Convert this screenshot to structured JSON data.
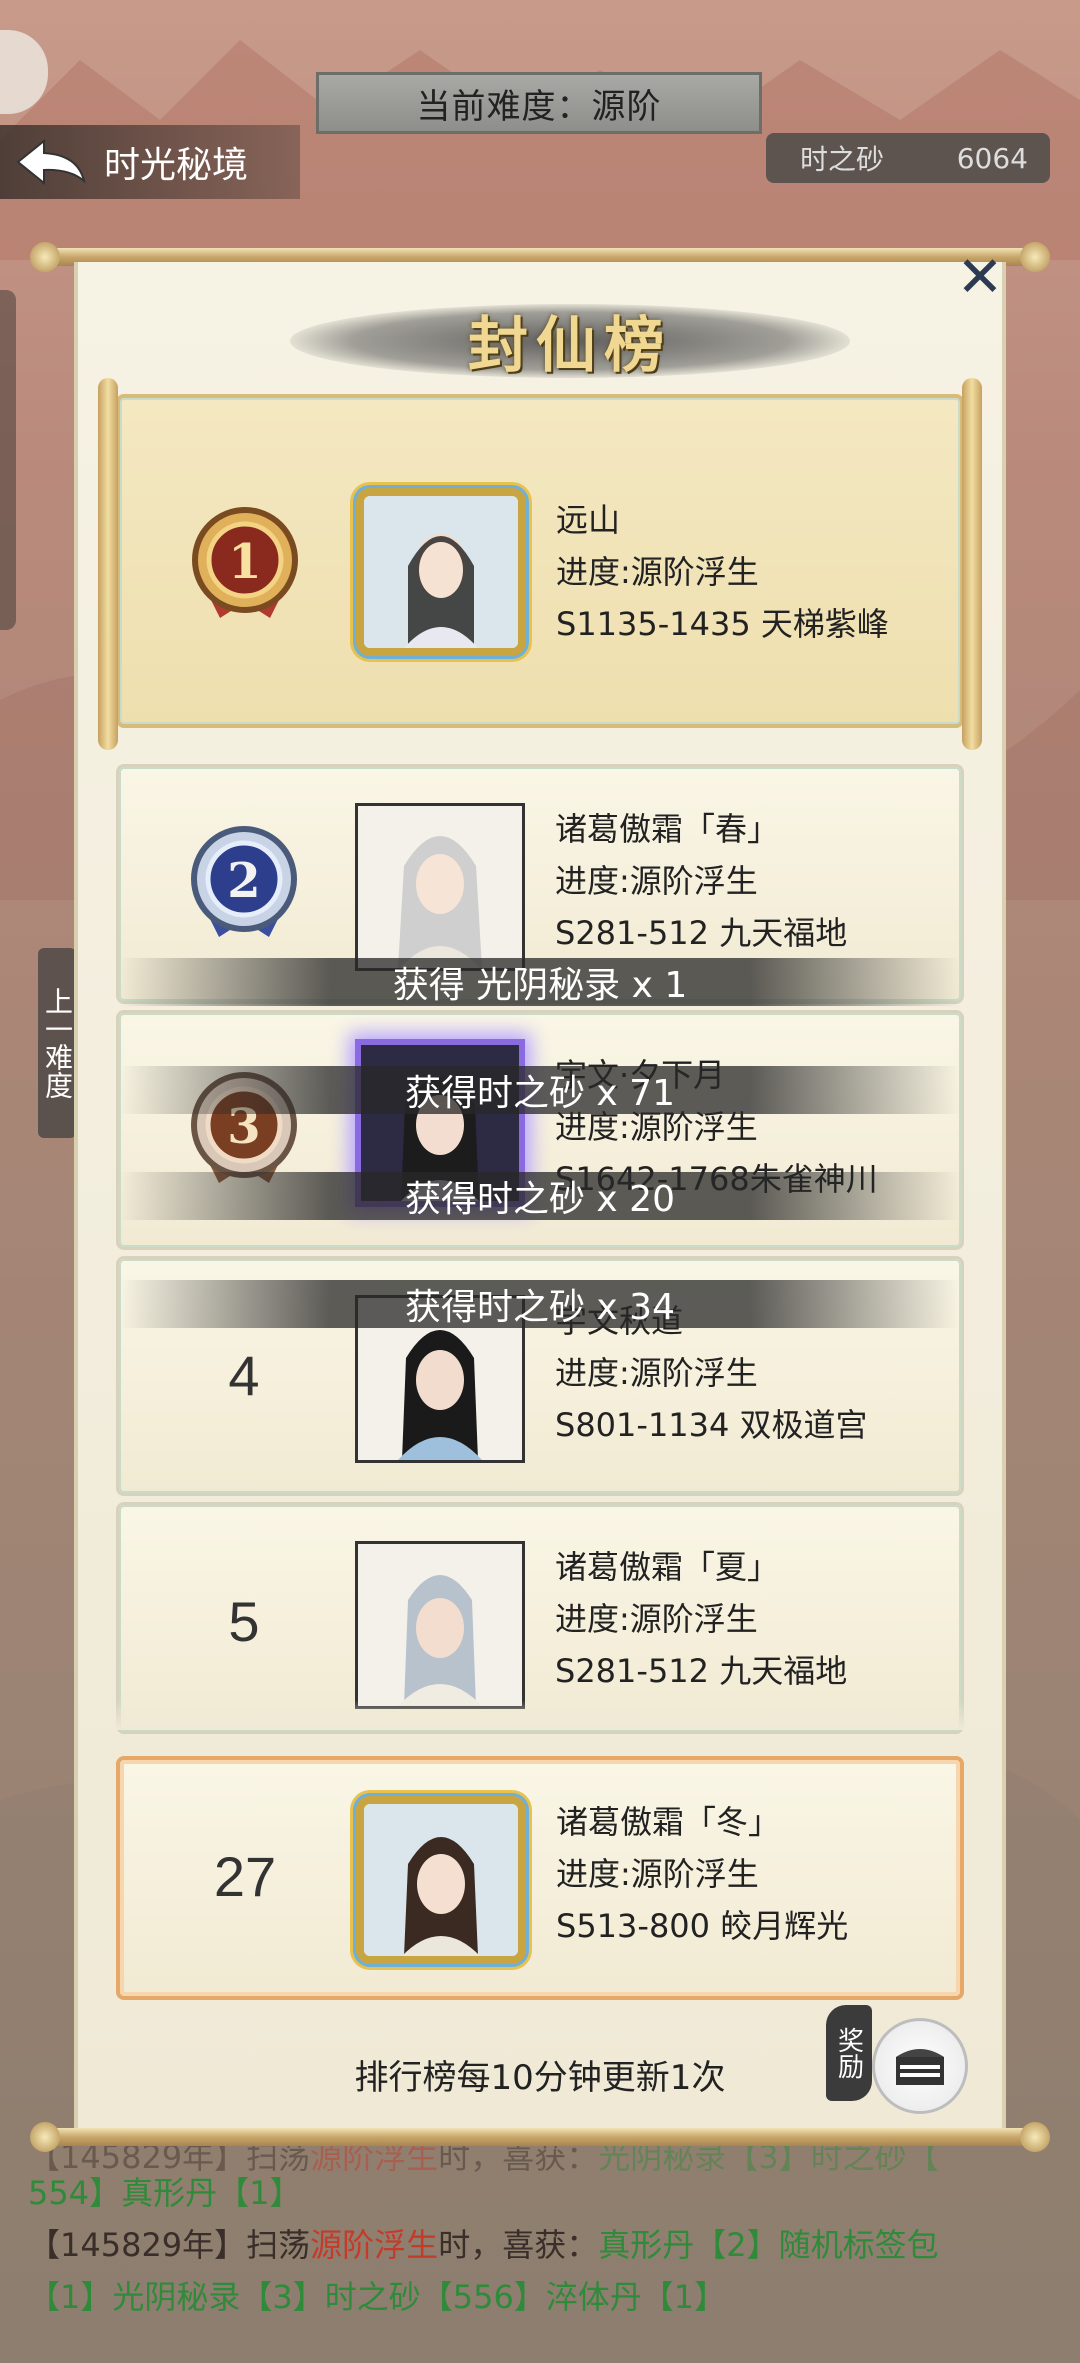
{
  "header": {
    "back_label": "时光秘境",
    "difficulty_label": "当前难度：源阶",
    "currency_label": "时之砂",
    "currency_value": "6064",
    "prev_difficulty_label": "上一难度"
  },
  "panel": {
    "title": "封仙榜",
    "close_label": "✕",
    "footer_note": "排行榜每10分钟更新1次",
    "reward_label": "奖励"
  },
  "ranks": [
    {
      "rank": "1",
      "name": "远山",
      "progress": "进度:源阶浮生",
      "server": "S1135-1435 天梯紫峰"
    },
    {
      "rank": "2",
      "name": "诸葛傲霜「春」",
      "progress": "进度:源阶浮生",
      "server": "S281-512 九天福地"
    },
    {
      "rank": "3",
      "name": "宇文·夕下月",
      "progress": "进度:源阶浮生",
      "server": "S1642-1768朱雀神川"
    },
    {
      "rank": "4",
      "name": "宇文秋道",
      "progress": "进度:源阶浮生",
      "server": "S801-1134 双极道宫"
    },
    {
      "rank": "5",
      "name": "诸葛傲霜「夏」",
      "progress": "进度:源阶浮生",
      "server": "S281-512 九天福地"
    }
  ],
  "my_rank": {
    "rank": "27",
    "name": "诸葛傲霜「冬」",
    "progress": "进度:源阶浮生",
    "server": "S513-800 皎月辉光"
  },
  "toasts": [
    "获得 光阴秘录 x 1",
    "获得时之砂 x 71",
    "获得时之砂 x 20",
    "获得时之砂 x 34"
  ],
  "log": {
    "line1": "【145829年】扫荡",
    "line1_red": "源阶浮生",
    "line1_rest": "时，喜获：",
    "line1_green": "光阴秘录【3】时之砂【",
    "line2": "554】真形丹【1】",
    "line3": "【145829年】扫荡",
    "line3_red": "源阶浮生",
    "line3_rest": "时，喜获：",
    "line3_green": "真形丹【2】随机标签包",
    "line4": "【1】光阴秘录【3】时之砂【556】淬体丹【1】"
  }
}
